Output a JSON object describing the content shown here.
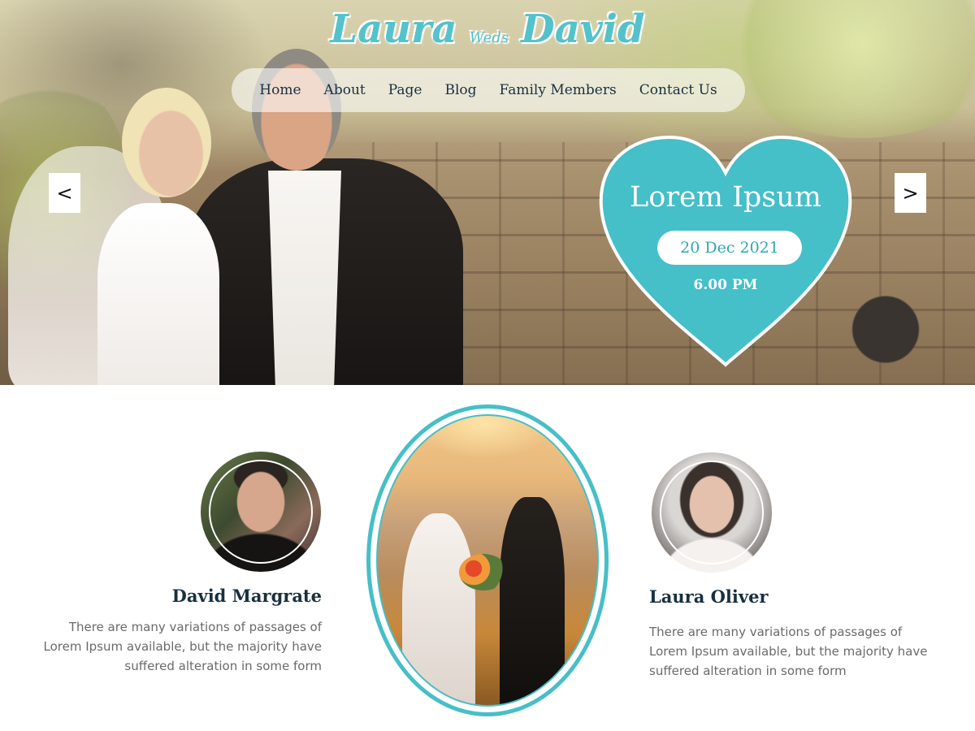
{
  "header": {
    "logo": {
      "first_name": "Laura",
      "connector": "Weds",
      "second_name": "David"
    },
    "nav": [
      "Home",
      "About",
      "Page",
      "Blog",
      "Family Members",
      "Contact Us"
    ]
  },
  "slider": {
    "prev_label": "<",
    "next_label": ">",
    "event": {
      "title": "Lorem Ipsum",
      "date": "20 Dec 2021",
      "time": "6.00 PM"
    }
  },
  "couple": {
    "groom": {
      "name": "David Margrate",
      "description": "There are many variations of passages of Lorem Ipsum available, but the majority have suffered alteration in some form"
    },
    "bride": {
      "name": "Laura Oliver",
      "description": "There are many variations of passages of Lorem Ipsum available, but the majority have suffered alteration in some form"
    }
  },
  "colors": {
    "accent": "#45bfc8",
    "heading": "#18303f",
    "body_text": "#6a6a6a"
  }
}
